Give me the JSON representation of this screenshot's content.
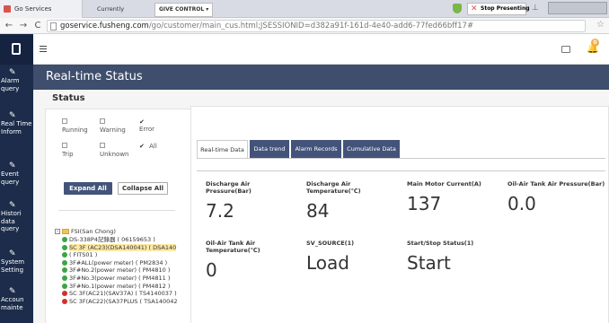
{
  "browser": {
    "tab_title": "Go Services",
    "presenting_text": "Currently presenting",
    "give_control": "GIVE CONTROL ▾",
    "stop_presenting": "Stop Presenting",
    "url_host": "goservice.fusheng.com",
    "url_path": "/go/customer/main_cus.html;JSESSIONID=d382a91f-161d-4e40-add6-77fed66bff17#",
    "back": "←",
    "forward": "→",
    "reload": "C",
    "star": "☆"
  },
  "sidebar": {
    "items": [
      {
        "label": "Alarm query",
        "icon": "wrench-icon"
      },
      {
        "label": "Real Time Inform",
        "icon": "wrench-icon"
      },
      {
        "label": "Event query",
        "icon": "wrench-icon"
      },
      {
        "label": "Histori data query",
        "icon": "wrench-icon"
      },
      {
        "label": "System Setting",
        "icon": "wrench-icon"
      },
      {
        "label": "Accoun mainte",
        "icon": "wrench-icon"
      }
    ]
  },
  "topbar": {
    "bell_badge": "0"
  },
  "page": {
    "title": "Real-time Status",
    "section": "Status"
  },
  "filters": {
    "checkboxes": [
      {
        "label": "Running",
        "checked": false
      },
      {
        "label": "Warning",
        "checked": false
      },
      {
        "label": "Error",
        "checked": true
      },
      {
        "label": "Trip",
        "checked": false
      },
      {
        "label": "Unknown",
        "checked": false
      },
      {
        "label": "All",
        "checked": true
      }
    ],
    "expand_all": "Expand All",
    "collapse_all": "Collapse All"
  },
  "tree": {
    "root": "FSI(San Chong)",
    "nodes": [
      {
        "label": "DS-338P4記錄器 ( 06159653 )",
        "status": "green",
        "selected": false
      },
      {
        "label": "SC 3F (AC23)(DSA140041) ( DSA140",
        "status": "green",
        "selected": true
      },
      {
        "label": "( FITS01 )",
        "status": "green",
        "selected": false
      },
      {
        "label": "3F#ALL(power meter) ( PM2834 )",
        "status": "green",
        "selected": false
      },
      {
        "label": "3F#No.2(power meter) ( PM4810 )",
        "status": "green",
        "selected": false
      },
      {
        "label": "3F#No.3(power meter) ( PM4811 )",
        "status": "green",
        "selected": false
      },
      {
        "label": "3F#No.1(power meter) ( PM4812 )",
        "status": "green",
        "selected": false
      },
      {
        "label": "SC 3F(AC21)(SAV37A) ( TS4140037 )",
        "status": "red",
        "selected": false
      },
      {
        "label": "SC 3F(AC22)(SA37PLUS ( TSA140042",
        "status": "red",
        "selected": false
      }
    ]
  },
  "tabs": [
    {
      "label": "Real-time Data",
      "active": true
    },
    {
      "label": "Data trend",
      "active": false
    },
    {
      "label": "Alarm Records",
      "active": false
    },
    {
      "label": "Cumulative Data",
      "active": false
    }
  ],
  "metrics": [
    {
      "label": "Discharge Air Pressure(Bar)",
      "value": "7.2"
    },
    {
      "label": "Discharge Air Temperature(℃)",
      "value": "84"
    },
    {
      "label": "Main Motor Current(A)",
      "value": "137"
    },
    {
      "label": "Oil-Air Tank Air Pressure(Bar)",
      "value": "0.0"
    },
    {
      "label": "Oil-Air Tank Air Temperature(℃)",
      "value": "0"
    },
    {
      "label": "SV_SOURCE(1)",
      "value": "Load"
    },
    {
      "label": "Start/Stop Status(1)",
      "value": "Start"
    }
  ]
}
